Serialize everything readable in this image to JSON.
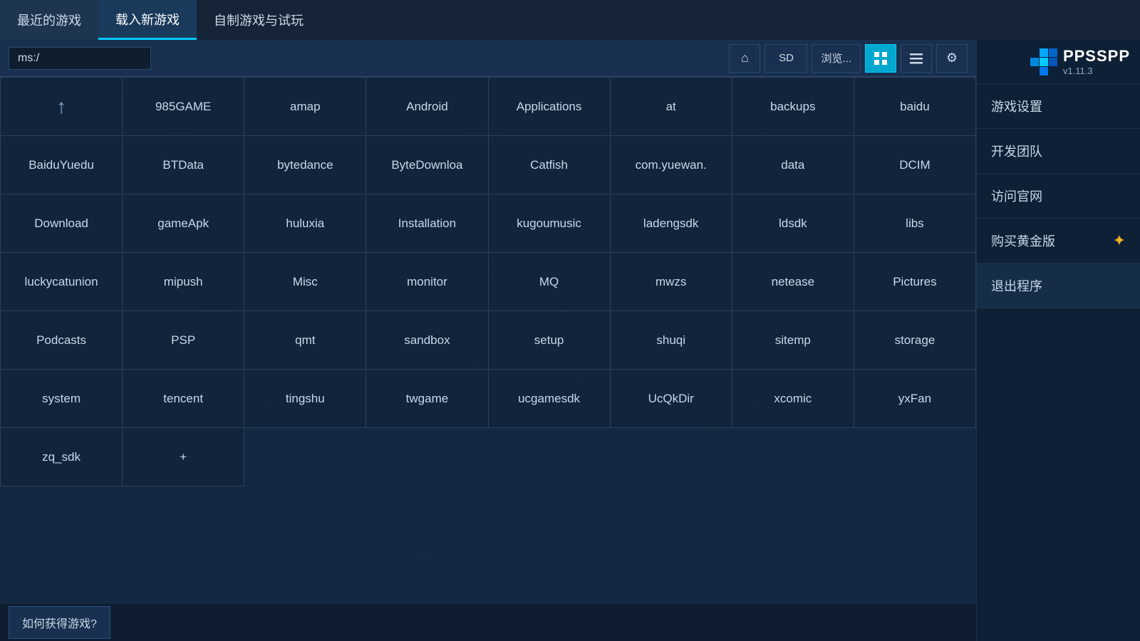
{
  "nav": {
    "tabs": [
      {
        "id": "recent",
        "label": "最近的游戏",
        "active": false
      },
      {
        "id": "load",
        "label": "载入新游戏",
        "active": true
      },
      {
        "id": "homebrew",
        "label": "自制游戏与试玩",
        "active": false
      }
    ]
  },
  "addressBar": {
    "path": "ms:/"
  },
  "toolbar": {
    "homeIcon": "⌂",
    "sdLabel": "SD",
    "browseLabel": "浏览...",
    "gridIcon": "▦",
    "listIcon": "≡",
    "settingsIcon": "⚙"
  },
  "grid": {
    "cells": [
      {
        "id": "up",
        "label": "↑",
        "type": "up"
      },
      {
        "id": "985game",
        "label": "985GAME"
      },
      {
        "id": "amap",
        "label": "amap"
      },
      {
        "id": "android",
        "label": "Android"
      },
      {
        "id": "applications",
        "label": "Applications"
      },
      {
        "id": "at",
        "label": "at"
      },
      {
        "id": "backups",
        "label": "backups"
      },
      {
        "id": "baidu",
        "label": "baidu"
      },
      {
        "id": "baiduyuedu",
        "label": "BaiduYuedu"
      },
      {
        "id": "btdata",
        "label": "BTData"
      },
      {
        "id": "bytedance",
        "label": "bytedance"
      },
      {
        "id": "bytedownload",
        "label": "ByteDownloa"
      },
      {
        "id": "catfish",
        "label": "Catfish"
      },
      {
        "id": "comyuewan",
        "label": "com.yuewan."
      },
      {
        "id": "data",
        "label": "data"
      },
      {
        "id": "dcim",
        "label": "DCIM"
      },
      {
        "id": "download",
        "label": "Download"
      },
      {
        "id": "gameapk",
        "label": "gameApk"
      },
      {
        "id": "huluxia",
        "label": "huluxia"
      },
      {
        "id": "installation",
        "label": "Installation"
      },
      {
        "id": "kugoumusic",
        "label": "kugoumusic"
      },
      {
        "id": "ladengsdk",
        "label": "ladengsdk"
      },
      {
        "id": "ldsdk",
        "label": "ldsdk"
      },
      {
        "id": "libs",
        "label": "libs"
      },
      {
        "id": "luckycatunion",
        "label": "luckycatunion"
      },
      {
        "id": "mipush",
        "label": "mipush"
      },
      {
        "id": "misc",
        "label": "Misc"
      },
      {
        "id": "monitor",
        "label": "monitor"
      },
      {
        "id": "mq",
        "label": "MQ"
      },
      {
        "id": "mwzs",
        "label": "mwzs"
      },
      {
        "id": "netease",
        "label": "netease"
      },
      {
        "id": "pictures",
        "label": "Pictures"
      },
      {
        "id": "podcasts",
        "label": "Podcasts"
      },
      {
        "id": "psp",
        "label": "PSP"
      },
      {
        "id": "qmt",
        "label": "qmt"
      },
      {
        "id": "sandbox",
        "label": "sandbox"
      },
      {
        "id": "setup",
        "label": "setup"
      },
      {
        "id": "shuqi",
        "label": "shuqi"
      },
      {
        "id": "sitemp",
        "label": "sitemp"
      },
      {
        "id": "storage",
        "label": "storage"
      },
      {
        "id": "system",
        "label": "system"
      },
      {
        "id": "tencent",
        "label": "tencent"
      },
      {
        "id": "tingshu",
        "label": "tingshu"
      },
      {
        "id": "twgame",
        "label": "twgame"
      },
      {
        "id": "ucgamesdk",
        "label": "ucgamesdk"
      },
      {
        "id": "ucqkdir",
        "label": "UcQkDir"
      },
      {
        "id": "xcomic",
        "label": "xcomic"
      },
      {
        "id": "yxfan",
        "label": "yxFan"
      },
      {
        "id": "zq_sdk",
        "label": "zq_sdk"
      },
      {
        "id": "plus",
        "label": "+"
      }
    ]
  },
  "bottomBar": {
    "howToGetGames": "如何获得游戏?"
  },
  "sidebar": {
    "logo": {
      "title": "PPSSPP",
      "version": "v1.11.3"
    },
    "menuItems": [
      {
        "id": "game-settings",
        "label": "游戏设置",
        "icon": null
      },
      {
        "id": "dev-team",
        "label": "开发团队",
        "icon": null
      },
      {
        "id": "official-site",
        "label": "访问官网",
        "icon": null
      },
      {
        "id": "buy-gold",
        "label": "购买黄金版",
        "icon": "star"
      },
      {
        "id": "exit",
        "label": "退出程序",
        "icon": null
      }
    ]
  }
}
